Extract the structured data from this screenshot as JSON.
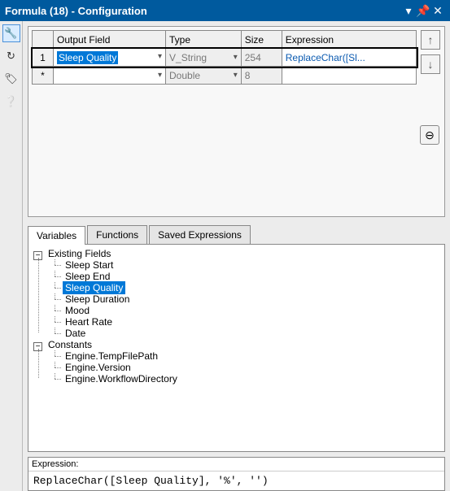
{
  "titlebar": {
    "title": "Formula (18) - Configuration"
  },
  "grid": {
    "headers": {
      "output_field": "Output Field",
      "type": "Type",
      "size": "Size",
      "expression": "Expression"
    },
    "rows": [
      {
        "idx": "1",
        "field": "Sleep Quality",
        "type": "V_String",
        "size": "254",
        "expr": "ReplaceChar([Sl..."
      },
      {
        "idx": "*",
        "field": "",
        "type": "Double",
        "size": "8",
        "expr": ""
      }
    ]
  },
  "tabs": {
    "variables": "Variables",
    "functions": "Functions",
    "saved": "Saved Expressions"
  },
  "tree": {
    "existing_label": "Existing Fields",
    "existing": [
      "Sleep Start",
      "Sleep End",
      "Sleep Quality",
      "Sleep Duration",
      "Mood",
      "Heart Rate",
      "Date"
    ],
    "selected_existing_index": 2,
    "constants_label": "Constants",
    "constants": [
      "Engine.TempFilePath",
      "Engine.Version",
      "Engine.WorkflowDirectory"
    ]
  },
  "expression": {
    "label": "Expression:",
    "text": "ReplaceChar([Sleep Quality], '%', '')"
  },
  "icons": {
    "arrow_up": "↑",
    "arrow_down": "↓",
    "minus_circle": "⊖",
    "wrench": "🔧",
    "refresh": "↻",
    "tag": "🏷",
    "help": "❔",
    "dropdown": "▾",
    "pin": "📌",
    "close": "✕",
    "expand": "−",
    "collapse": "+"
  }
}
